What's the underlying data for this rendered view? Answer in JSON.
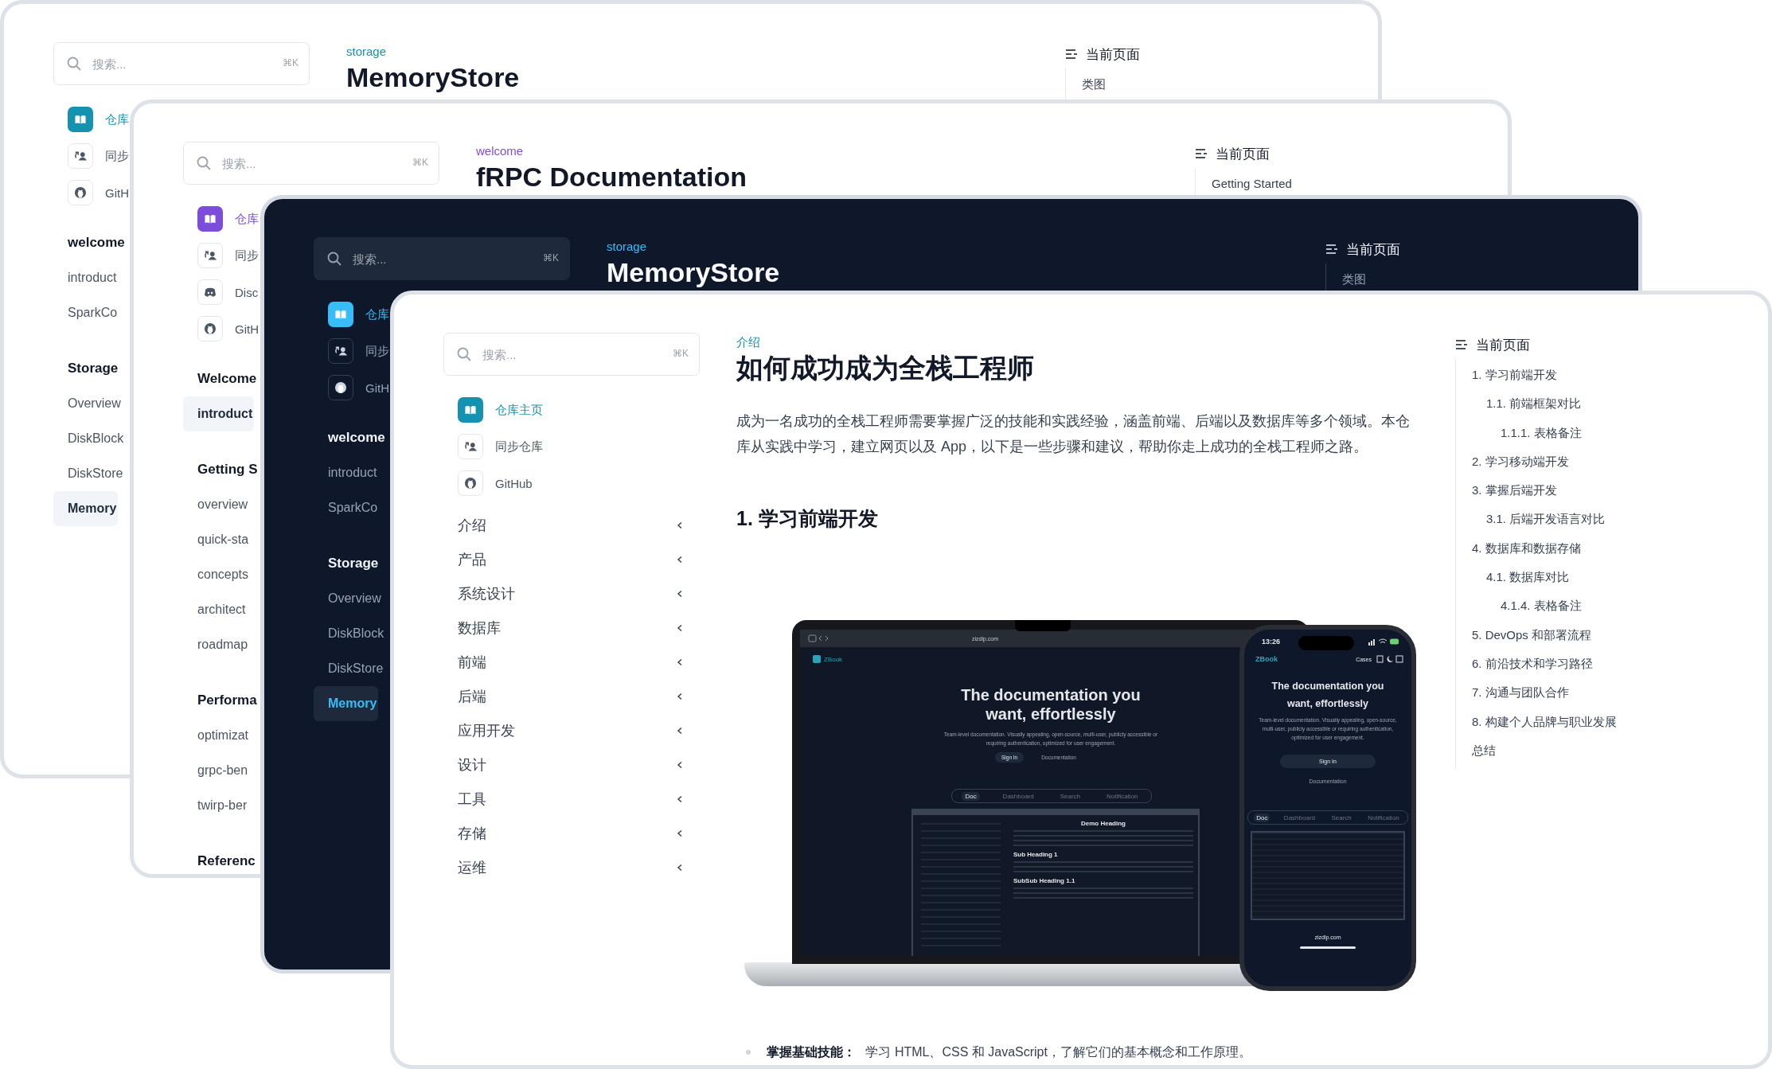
{
  "windows": [
    {
      "kind": "light",
      "color": "#1592b0",
      "search": {
        "placeholder": "搜索...",
        "shortcut": "⌘K"
      },
      "links": [
        {
          "kind": "book",
          "label": "仓库",
          "selected": true
        },
        {
          "kind": "sync",
          "label": "同步",
          "selected": false
        },
        {
          "kind": "github",
          "label": "GitH",
          "selected": false
        }
      ],
      "nav": [
        {
          "kind": "heading",
          "label": "welcome"
        },
        {
          "kind": "link",
          "label": "introduct",
          "selected": false
        },
        {
          "kind": "link",
          "label": "SparkCo",
          "selected": false
        },
        {
          "kind": "heading",
          "label": "Storage"
        },
        {
          "kind": "link",
          "label": "Overview",
          "selected": false
        },
        {
          "kind": "link",
          "label": "DiskBlock",
          "selected": false
        },
        {
          "kind": "link",
          "label": "DiskStore",
          "selected": false
        },
        {
          "kind": "link",
          "label": "Memory",
          "selected": true
        }
      ],
      "page": {
        "section": "storage",
        "title": "MemoryStore"
      },
      "toc": {
        "title": "当前页面",
        "items": [
          {
            "label": "类图"
          }
        ]
      }
    },
    {
      "kind": "light",
      "color": "#7c4ddb",
      "search": {
        "placeholder": "搜索...",
        "shortcut": "⌘K"
      },
      "links": [
        {
          "kind": "book",
          "label": "仓库",
          "selected": true
        },
        {
          "kind": "sync",
          "label": "同步",
          "selected": false
        },
        {
          "kind": "discord",
          "label": "Disc",
          "selected": false
        },
        {
          "kind": "github",
          "label": "GitH",
          "selected": false
        }
      ],
      "nav": [
        {
          "kind": "heading",
          "label": "Welcome"
        },
        {
          "kind": "link",
          "label": "introduct",
          "selected": true
        },
        {
          "kind": "heading",
          "label": "Getting S"
        },
        {
          "kind": "link",
          "label": "overview",
          "selected": false
        },
        {
          "kind": "link",
          "label": "quick-sta",
          "selected": false
        },
        {
          "kind": "link",
          "label": "concepts",
          "selected": false
        },
        {
          "kind": "link",
          "label": "architect",
          "selected": false
        },
        {
          "kind": "link",
          "label": "roadmap",
          "selected": false
        },
        {
          "kind": "heading",
          "label": "Performa"
        },
        {
          "kind": "link",
          "label": "optimizat",
          "selected": false
        },
        {
          "kind": "link",
          "label": "grpc-ben",
          "selected": false
        },
        {
          "kind": "link",
          "label": "twirp-ber",
          "selected": false
        },
        {
          "kind": "heading",
          "label": "Referenc"
        }
      ],
      "page": {
        "section": "welcome",
        "title": "fRPC Documentation"
      },
      "toc": {
        "title": "当前页面",
        "items": [
          {
            "label": "Getting Started"
          }
        ]
      }
    },
    {
      "kind": "dark",
      "color": "#38bdf8",
      "search": {
        "placeholder": "搜索...",
        "shortcut": "⌘K"
      },
      "links": [
        {
          "kind": "book",
          "label": "仓库",
          "selected": true
        },
        {
          "kind": "sync",
          "label": "同步",
          "selected": false
        },
        {
          "kind": "github",
          "label": "GitH",
          "selected": false
        }
      ],
      "nav": [
        {
          "kind": "heading",
          "label": "welcome"
        },
        {
          "kind": "link",
          "label": "introduct",
          "selected": false
        },
        {
          "kind": "link",
          "label": "SparkCo",
          "selected": false
        },
        {
          "kind": "heading",
          "label": "Storage"
        },
        {
          "kind": "link",
          "label": "Overview",
          "selected": false
        },
        {
          "kind": "link",
          "label": "DiskBlock",
          "selected": false
        },
        {
          "kind": "link",
          "label": "DiskStore",
          "selected": false
        },
        {
          "kind": "link",
          "label": "Memory",
          "selected": true
        }
      ],
      "page": {
        "section": "storage",
        "title": "MemoryStore"
      },
      "toc": {
        "title": "当前页面",
        "items": [
          {
            "label": "类图"
          }
        ]
      }
    },
    {
      "kind": "light",
      "color": "#1592b0",
      "search": {
        "placeholder": "搜索...",
        "shortcut": "⌘K"
      },
      "links": [
        {
          "kind": "book",
          "label": "仓库主页",
          "selected": true
        },
        {
          "kind": "sync",
          "label": "同步仓库",
          "selected": false
        },
        {
          "kind": "github",
          "label": "GitHub",
          "selected": false
        }
      ],
      "nav": [
        {
          "kind": "folder",
          "label": "介绍",
          "expanded": false
        },
        {
          "kind": "folder",
          "label": "产品",
          "expanded": false
        },
        {
          "kind": "folder",
          "label": "系统设计",
          "expanded": false
        },
        {
          "kind": "folder",
          "label": "数据库",
          "expanded": false
        },
        {
          "kind": "folder",
          "label": "前端",
          "expanded": false
        },
        {
          "kind": "folder",
          "label": "后端",
          "expanded": false
        },
        {
          "kind": "folder",
          "label": "应用开发",
          "expanded": false
        },
        {
          "kind": "folder",
          "label": "设计",
          "expanded": false
        },
        {
          "kind": "folder",
          "label": "工具",
          "expanded": false
        },
        {
          "kind": "folder",
          "label": "存储",
          "expanded": false
        },
        {
          "kind": "folder",
          "label": "运维",
          "expanded": false
        }
      ],
      "page": {
        "section": "介绍",
        "title": "如何成功成为全栈工程师",
        "intro": "成为一名成功的全栈工程师需要掌握广泛的技能和实践经验，涵盖前端、后端以及数据库等多个领域。本仓库从实践中学习，建立网页以及 App，以下是一些步骤和建议，帮助你走上成功的全栈工程师之路。",
        "heading": "1. 学习前端开发",
        "figure": {
          "laptop": {
            "url": "zizdlp.com",
            "brand": "ZBook",
            "headline": "The documentation you want, effortlessly",
            "description": "Team-level documentation. Visually appealing, open-source, multi-user, publicly accessible or requiring authentication, optimized for user engagement.",
            "buttons": [
              "Sign In",
              "Documentation"
            ],
            "tabs": [
              {
                "label": "Doc",
                "selected": true
              },
              {
                "label": "Dashboard",
                "selected": false
              },
              {
                "label": "Search",
                "selected": false
              },
              {
                "label": "Notification",
                "selected": false
              }
            ],
            "preview": {
              "title": "Demo Heading",
              "sections": [
                "Sub Heading 1",
                "SubSub Heading 1.1"
              ]
            }
          },
          "phone": {
            "time": "13:26",
            "brand": "ZBook",
            "menu": "Cases",
            "headline": "The documentation you want, effortlessly",
            "description": "Team-level documentation. Visually appealing, open-source, multi-user, publicly accessible or requiring authentication, optimized for user engagement.",
            "buttons": [
              "Sign In",
              "Documentation"
            ],
            "tabs": [
              {
                "label": "Doc",
                "selected": true
              },
              {
                "label": "Dashboard",
                "selected": false
              },
              {
                "label": "Search",
                "selected": false
              },
              {
                "label": "Notification",
                "selected": false
              }
            ],
            "url": "zizdlp.com"
          }
        },
        "bullets": [
          "**掌握基础技能：** 学习 HTML、CSS 和 JavaScript，了解它们的基本概念和工作原理。"
        ]
      },
      "toc": {
        "title": "当前页面",
        "items": [
          {
            "label": "1. 学习前端开发",
            "children": [
              {
                "label": "1.1. 前端框架对比",
                "children": [
                  {
                    "label": "1.1.1. 表格备注"
                  }
                ]
              }
            ]
          },
          {
            "label": "2. 学习移动端开发"
          },
          {
            "label": "3. 掌握后端开发",
            "children": [
              {
                "label": "3.1. 后端开发语言对比"
              }
            ]
          },
          {
            "label": "4. 数据库和数据存储",
            "children": [
              {
                "label": "4.1. 数据库对比",
                "children": [
                  {
                    "label": "4.1.4. 表格备注"
                  }
                ]
              }
            ]
          },
          {
            "label": "5. DevOps 和部署流程"
          },
          {
            "label": "6. 前沿技术和学习路径"
          },
          {
            "label": "7. 沟通与团队合作"
          },
          {
            "label": "8. 构建个人品牌与职业发展"
          },
          {
            "label": "总结"
          }
        ]
      }
    }
  ]
}
